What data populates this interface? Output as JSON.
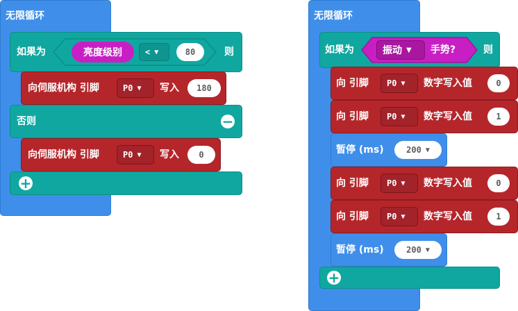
{
  "left": {
    "forever_label": "无限循环",
    "if_label": "如果为",
    "then_label": "则",
    "else_label": "否则",
    "cond_reporter": "亮度级别",
    "cond_operator": "<",
    "cond_value": "80",
    "servo_label": "向伺服机构 引脚",
    "servo_pin": "P0",
    "write_label": "写入",
    "servo_val1": "180",
    "servo_val2": "0"
  },
  "right": {
    "forever_label": "无限循环",
    "if_label": "如果为",
    "then_label": "则",
    "gesture_label": "振动",
    "gesture_suffix": "手势?",
    "digital_prefix": "向 引脚",
    "pin": "P0",
    "digital_label": "数字写入值",
    "val0": "0",
    "val1": "1",
    "pause_label": "暂停 (ms)",
    "pause_val": "200"
  },
  "icons": {
    "minus": "−",
    "plus": "+",
    "dropdown": "▼"
  },
  "colors": {
    "forever_blue": "#3f8fea",
    "logic_teal": "#10a7a0",
    "pins_red": "#b5262b",
    "input_magenta": "#c81fc4"
  }
}
